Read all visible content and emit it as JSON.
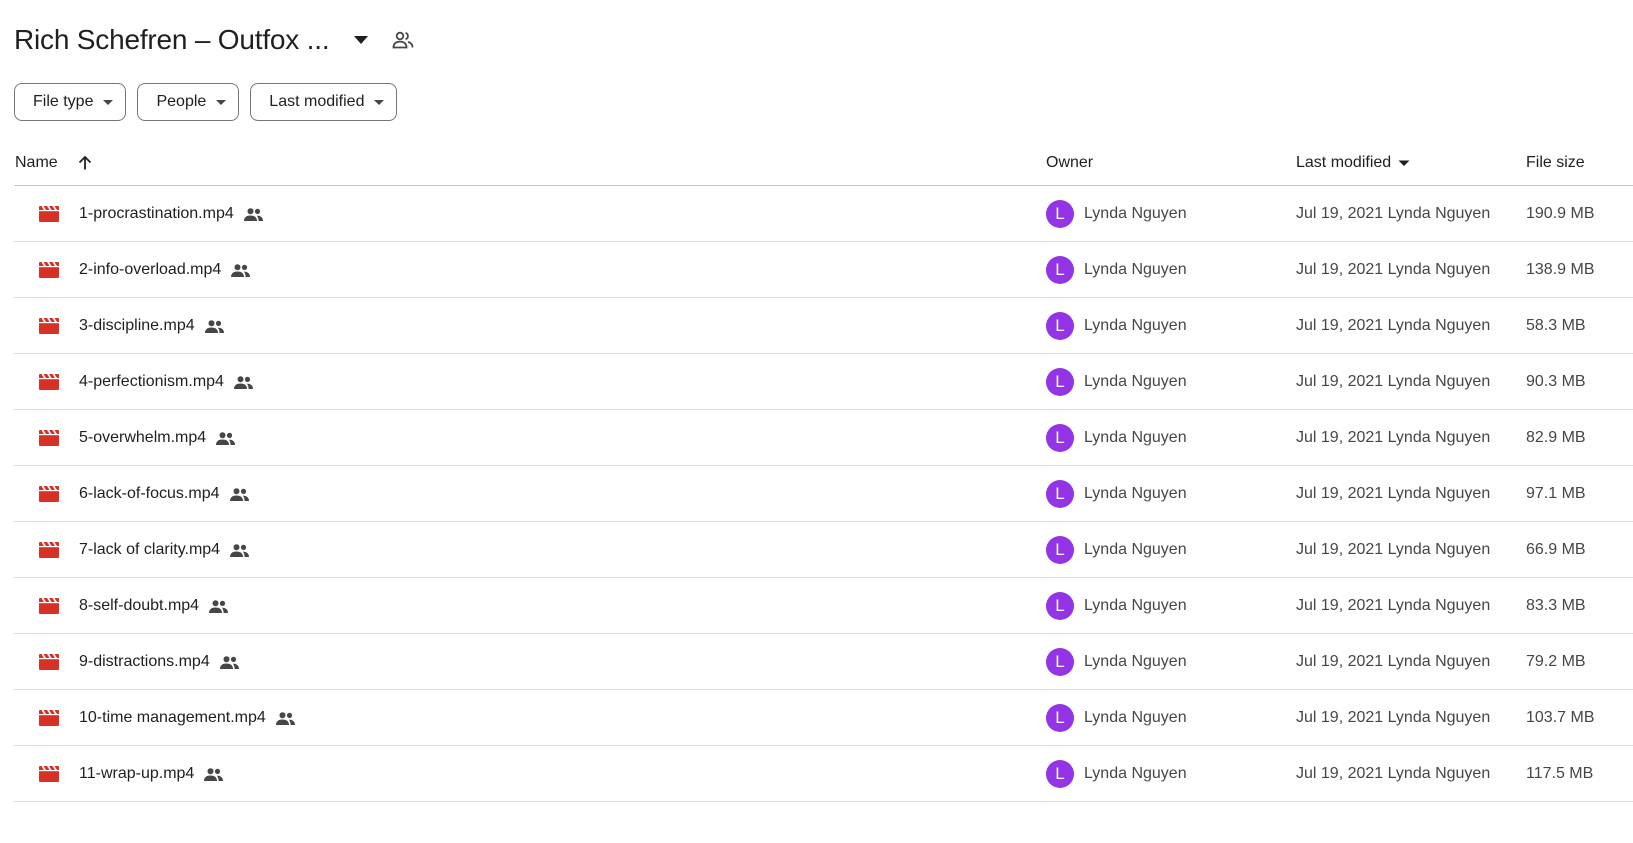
{
  "header": {
    "title": "Rich Schefren – Outfox ...",
    "dropdown_icon": "arrow-drop-down-icon",
    "share_icon": "people-outline-icon"
  },
  "filters": [
    {
      "label": "File type"
    },
    {
      "label": "People"
    },
    {
      "label": "Last modified"
    }
  ],
  "columns": {
    "name": "Name",
    "owner": "Owner",
    "last_modified": "Last modified",
    "file_size": "File size"
  },
  "colors": {
    "video_icon": "#d93025",
    "avatar_bg": "#9334e6",
    "border": "#dadce0"
  },
  "files": [
    {
      "name": "1-procrastination.mp4",
      "owner": "Lynda Nguyen",
      "avatar": "L",
      "modified": "Jul 19, 2021 Lynda Nguyen",
      "size": "190.9 MB"
    },
    {
      "name": "2-info-overload.mp4",
      "owner": "Lynda Nguyen",
      "avatar": "L",
      "modified": "Jul 19, 2021 Lynda Nguyen",
      "size": "138.9 MB"
    },
    {
      "name": "3-discipline.mp4",
      "owner": "Lynda Nguyen",
      "avatar": "L",
      "modified": "Jul 19, 2021 Lynda Nguyen",
      "size": "58.3 MB"
    },
    {
      "name": "4-perfectionism.mp4",
      "owner": "Lynda Nguyen",
      "avatar": "L",
      "modified": "Jul 19, 2021 Lynda Nguyen",
      "size": "90.3 MB"
    },
    {
      "name": "5-overwhelm.mp4",
      "owner": "Lynda Nguyen",
      "avatar": "L",
      "modified": "Jul 19, 2021 Lynda Nguyen",
      "size": "82.9 MB"
    },
    {
      "name": "6-lack-of-focus.mp4",
      "owner": "Lynda Nguyen",
      "avatar": "L",
      "modified": "Jul 19, 2021 Lynda Nguyen",
      "size": "97.1 MB"
    },
    {
      "name": "7-lack of clarity.mp4",
      "owner": "Lynda Nguyen",
      "avatar": "L",
      "modified": "Jul 19, 2021 Lynda Nguyen",
      "size": "66.9 MB"
    },
    {
      "name": "8-self-doubt.mp4",
      "owner": "Lynda Nguyen",
      "avatar": "L",
      "modified": "Jul 19, 2021 Lynda Nguyen",
      "size": "83.3 MB"
    },
    {
      "name": "9-distractions.mp4",
      "owner": "Lynda Nguyen",
      "avatar": "L",
      "modified": "Jul 19, 2021 Lynda Nguyen",
      "size": "79.2 MB"
    },
    {
      "name": "10-time management.mp4",
      "owner": "Lynda Nguyen",
      "avatar": "L",
      "modified": "Jul 19, 2021 Lynda Nguyen",
      "size": "103.7 MB"
    },
    {
      "name": "11-wrap-up.mp4",
      "owner": "Lynda Nguyen",
      "avatar": "L",
      "modified": "Jul 19, 2021 Lynda Nguyen",
      "size": "117.5 MB"
    }
  ]
}
